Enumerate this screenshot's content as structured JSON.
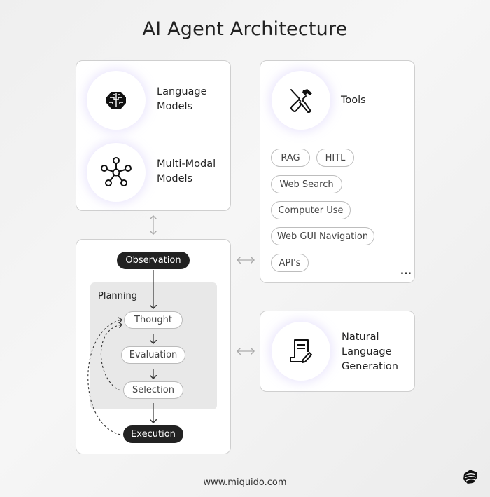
{
  "title": "AI Agent Architecture",
  "models_card": {
    "items": [
      {
        "icon": "brain-icon",
        "label_line1": "Language",
        "label_line2": "Models"
      },
      {
        "icon": "network-hub-icon",
        "label_line1": "Multi-Modal",
        "label_line2": "Models"
      }
    ]
  },
  "tools_card": {
    "icon": "hammer-screwdriver-icon",
    "label": "Tools",
    "chips": [
      "RAG",
      "HITL",
      "Web Search",
      "Computer Use",
      "Web GUI Navigation",
      "API's"
    ],
    "more": "..."
  },
  "agent_card": {
    "observation": "Observation",
    "planning_label": "Planning",
    "steps": [
      "Thought",
      "Evaluation",
      "Selection"
    ],
    "execution": "Execution"
  },
  "nlg_card": {
    "icon": "document-pen-icon",
    "label_line1": "Natural",
    "label_line2": "Language",
    "label_line3": "Generation"
  },
  "footer": {
    "url": "www.miquido.com",
    "logo": "miquido-logo-icon"
  }
}
